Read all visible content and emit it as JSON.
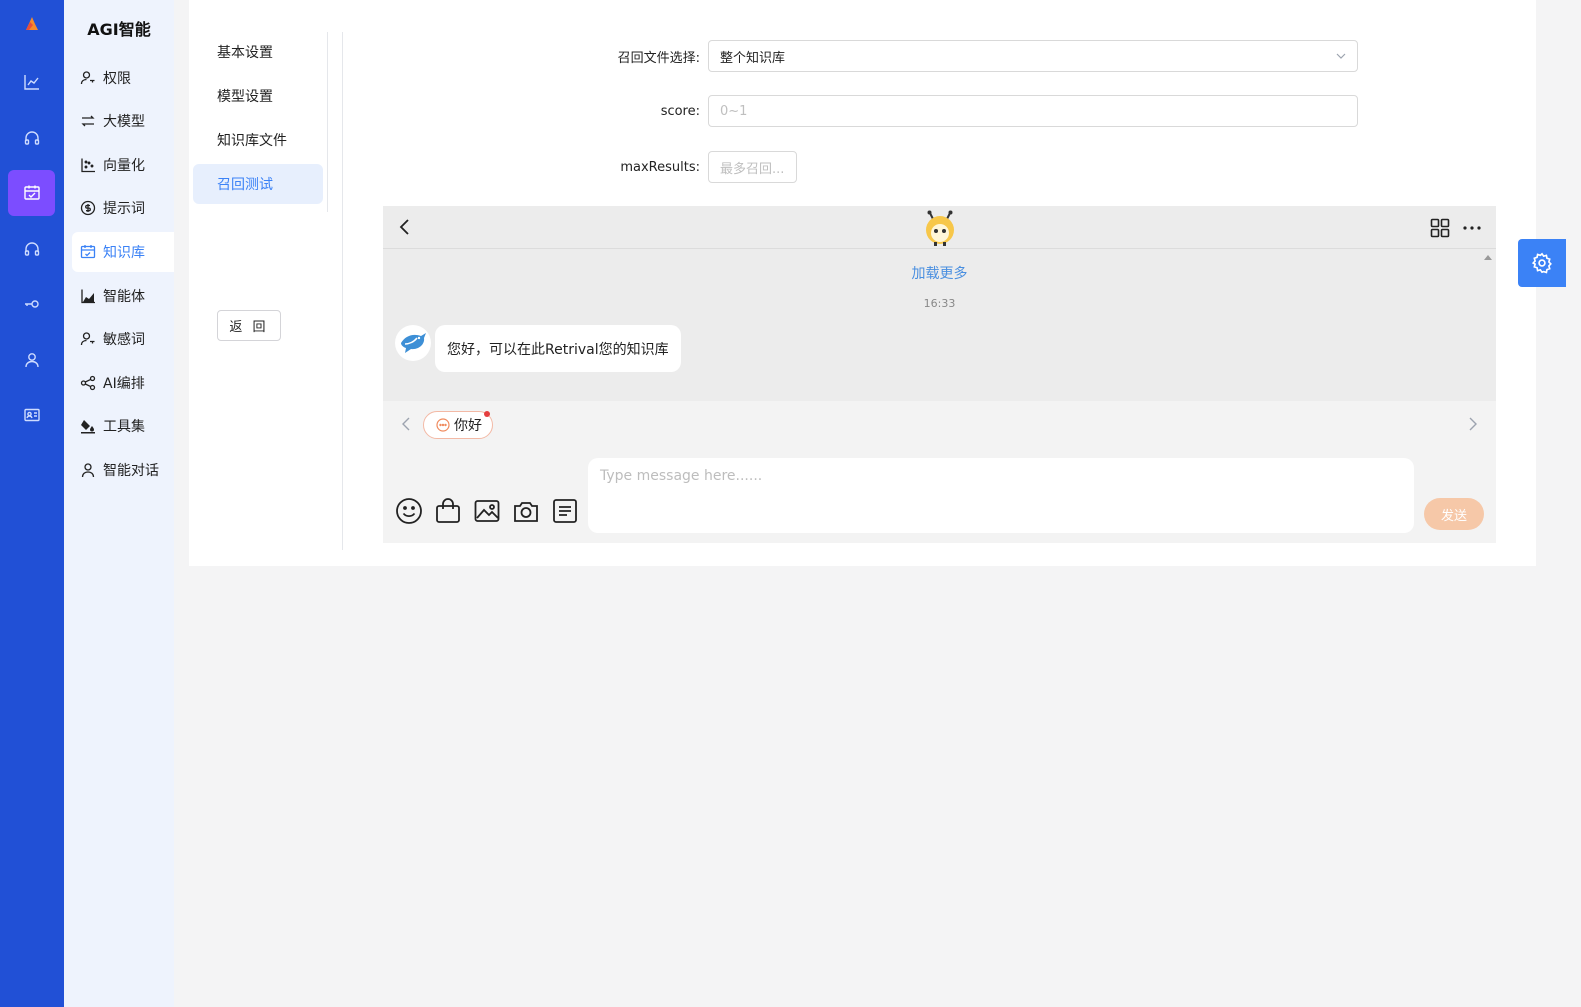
{
  "app": {
    "brand": "AGI智能"
  },
  "menu": {
    "items": [
      {
        "label": "权限",
        "icon": "user-key-icon"
      },
      {
        "label": "大模型",
        "icon": "arrows-icon"
      },
      {
        "label": "向量化",
        "icon": "scatter-icon"
      },
      {
        "label": "提示词",
        "icon": "dollar-circle-icon"
      },
      {
        "label": "知识库",
        "icon": "calendar-check-icon",
        "active": true
      },
      {
        "label": "智能体",
        "icon": "area-chart-icon"
      },
      {
        "label": "敏感词",
        "icon": "user-key-icon"
      },
      {
        "label": "AI编排",
        "icon": "share-icon"
      },
      {
        "label": "工具集",
        "icon": "paint-bucket-icon"
      },
      {
        "label": "智能对话",
        "icon": "user-icon"
      }
    ]
  },
  "subnav": {
    "items": [
      "基本设置",
      "模型设置",
      "知识库文件",
      "召回测试"
    ],
    "active_index": 3,
    "back_label": "返 回"
  },
  "form": {
    "file_label": "召回文件选择:",
    "file_value": "整个知识库",
    "score_label": "score:",
    "score_placeholder": "0~1",
    "max_label": "maxResults:",
    "max_placeholder": "最多召回..."
  },
  "chat": {
    "load_more": "加载更多",
    "time": "16:33",
    "message": "您好，可以在此Retrival您的知识库",
    "quick_reply": "你好",
    "input_placeholder": "Type message here......",
    "send_label": "发送"
  },
  "colors": {
    "rail": "#2150d6",
    "rail_active": "#7c4dff",
    "accent": "#3b82f6",
    "send": "#f6c8a8"
  }
}
